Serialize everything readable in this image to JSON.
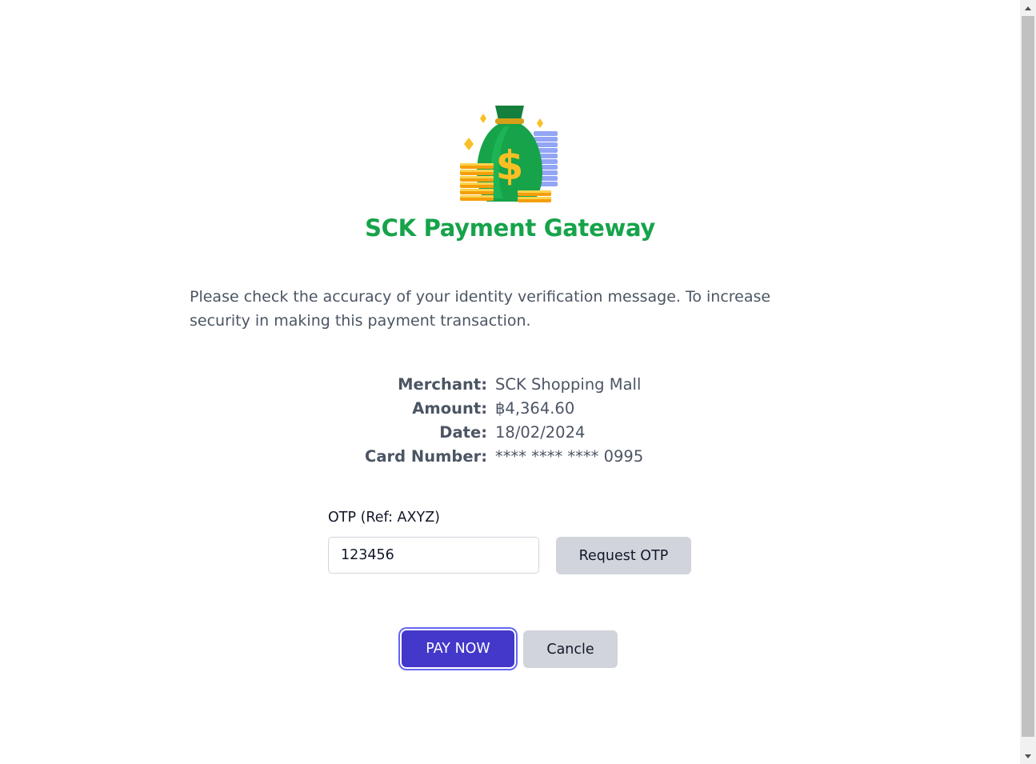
{
  "header": {
    "title": "SCK Payment Gateway",
    "logo_icon": "money-bag-icon"
  },
  "message": "Please check the accuracy of your identity verification message. To increase security in making this payment transaction.",
  "details": {
    "merchant_label": "Merchant:",
    "merchant_value": "SCK Shopping Mall",
    "amount_label": "Amount:",
    "amount_value": "฿4,364.60",
    "date_label": "Date:",
    "date_value": "18/02/2024",
    "card_label": "Card Number:",
    "card_value": "**** **** **** 0995"
  },
  "otp": {
    "label": "OTP (Ref: AXYZ)",
    "value": "123456",
    "request_button": "Request OTP"
  },
  "actions": {
    "pay_label": "PAY NOW",
    "cancel_label": "Cancle"
  },
  "colors": {
    "title": "#16a34a",
    "pay_button": "#4338ca",
    "secondary_button": "#d1d5db"
  }
}
